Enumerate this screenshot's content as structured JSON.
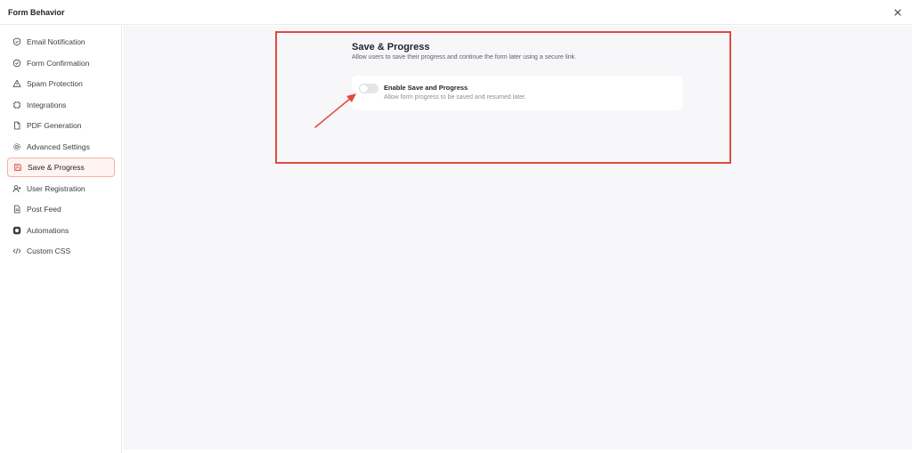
{
  "window": {
    "title": "Form Behavior",
    "close_icon": "close-icon"
  },
  "sidebar": {
    "items": [
      {
        "label": "Email Notification",
        "icon": "shield-check-icon",
        "active": false
      },
      {
        "label": "Form Confirmation",
        "icon": "check-circle-icon",
        "active": false
      },
      {
        "label": "Spam Protection",
        "icon": "warning-triangle-icon",
        "active": false
      },
      {
        "label": "Integrations",
        "icon": "integrations-icon",
        "active": false
      },
      {
        "label": "PDF Generation",
        "icon": "file-icon",
        "active": false
      },
      {
        "label": "Advanced Settings",
        "icon": "gear-icon",
        "active": false
      },
      {
        "label": "Save & Progress",
        "icon": "save-icon",
        "active": true
      },
      {
        "label": "User Registration",
        "icon": "user-plus-icon",
        "active": false
      },
      {
        "label": "Post Feed",
        "icon": "document-icon",
        "active": false
      },
      {
        "label": "Automations",
        "icon": "automation-icon",
        "active": false
      },
      {
        "label": "Custom CSS",
        "icon": "code-icon",
        "active": false
      }
    ]
  },
  "main": {
    "section_title": "Save & Progress",
    "section_description": "Allow users to save their progress and continue the form later using a secure link.",
    "option": {
      "label": "Enable Save and Progress",
      "hint": "Allow form progress to be saved and resumed later.",
      "enabled": false
    }
  },
  "colors": {
    "accent": "#e04a3f",
    "active_bg": "#fff4f1",
    "active_border": "#f2b3a3",
    "main_bg": "#f7f7f9"
  }
}
